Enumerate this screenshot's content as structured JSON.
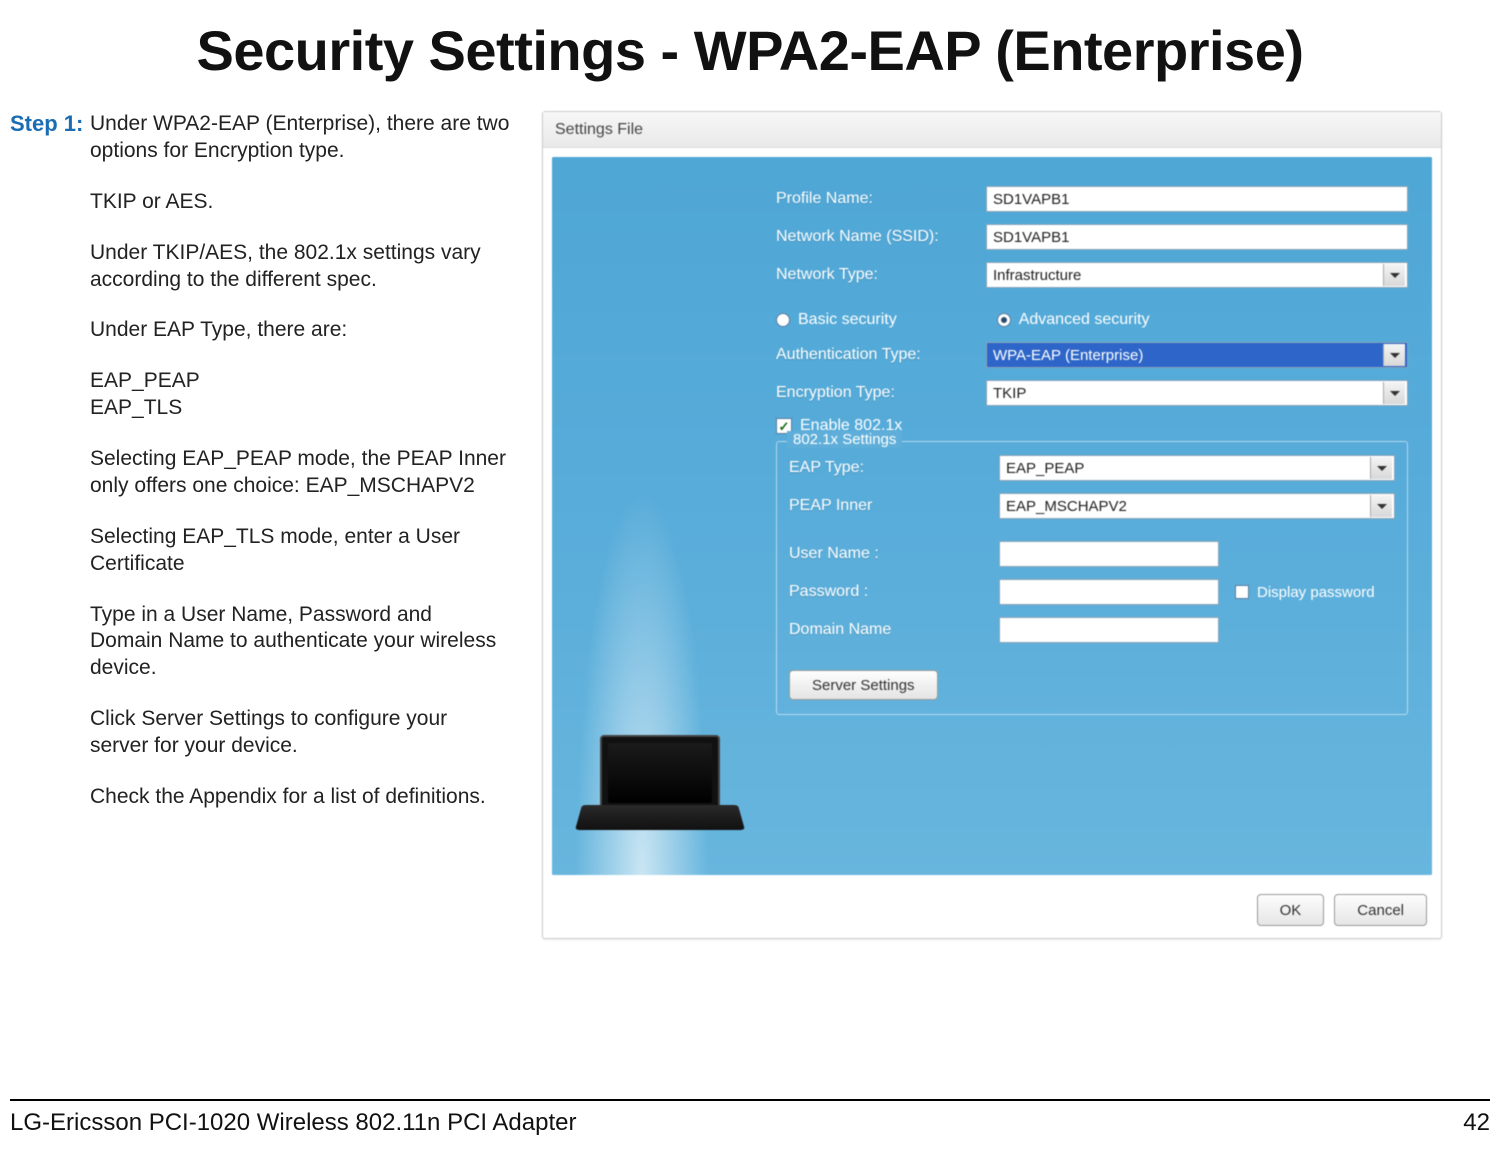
{
  "title": "Security Settings - WPA2-EAP (Enterprise)",
  "step_label": "Step 1:",
  "step": {
    "p1": "Under WPA2-EAP (Enterprise), there are two options for Encryption type.",
    "p2": "TKIP or AES.",
    "p3": "Under TKIP/AES, the 802.1x settings vary according to the different spec.",
    "p4": "Under EAP Type, there are:",
    "p5a": "EAP_PEAP",
    "p5b": "EAP_TLS",
    "p6": "Selecting EAP_PEAP mode, the PEAP Inner only offers one choice: EAP_MSCHAPV2",
    "p7": "Selecting EAP_TLS mode, enter a User Certificate",
    "p8": "Type in a User Name, Password and Domain Name to authenticate your wireless device.",
    "p9": "Click Server Settings to configure your server for your device.",
    "p10": "Check the Appendix for a list of definitions."
  },
  "dialog": {
    "menu": "Settings File",
    "labels": {
      "profile_name": "Profile Name:",
      "ssid": "Network Name (SSID):",
      "net_type": "Network Type:",
      "basic_sec": "Basic security",
      "adv_sec": "Advanced security",
      "auth_type": "Authentication Type:",
      "enc_type": "Encryption Type:",
      "enable_8021x": "Enable 802.1x",
      "legend": "802.1x Settings",
      "eap_type": "EAP Type:",
      "peap_inner": "PEAP Inner",
      "user_name": "User Name :",
      "password": "Password :",
      "display_pw": "Display password",
      "domain_name": "Domain Name",
      "server_settings": "Server Settings",
      "ok": "OK",
      "cancel": "Cancel"
    },
    "values": {
      "profile_name": "SD1VAPB1",
      "ssid": "SD1VAPB1",
      "net_type": "Infrastructure",
      "auth_type": "WPA-EAP (Enterprise)",
      "enc_type": "TKIP",
      "eap_type": "EAP_PEAP",
      "peap_inner": "EAP_MSCHAPV2",
      "user_name": "",
      "password": "",
      "domain_name": ""
    }
  },
  "footer": {
    "product": "LG-Ericsson PCI-1020 Wireless 802.11n PCI Adapter",
    "page": "42"
  }
}
